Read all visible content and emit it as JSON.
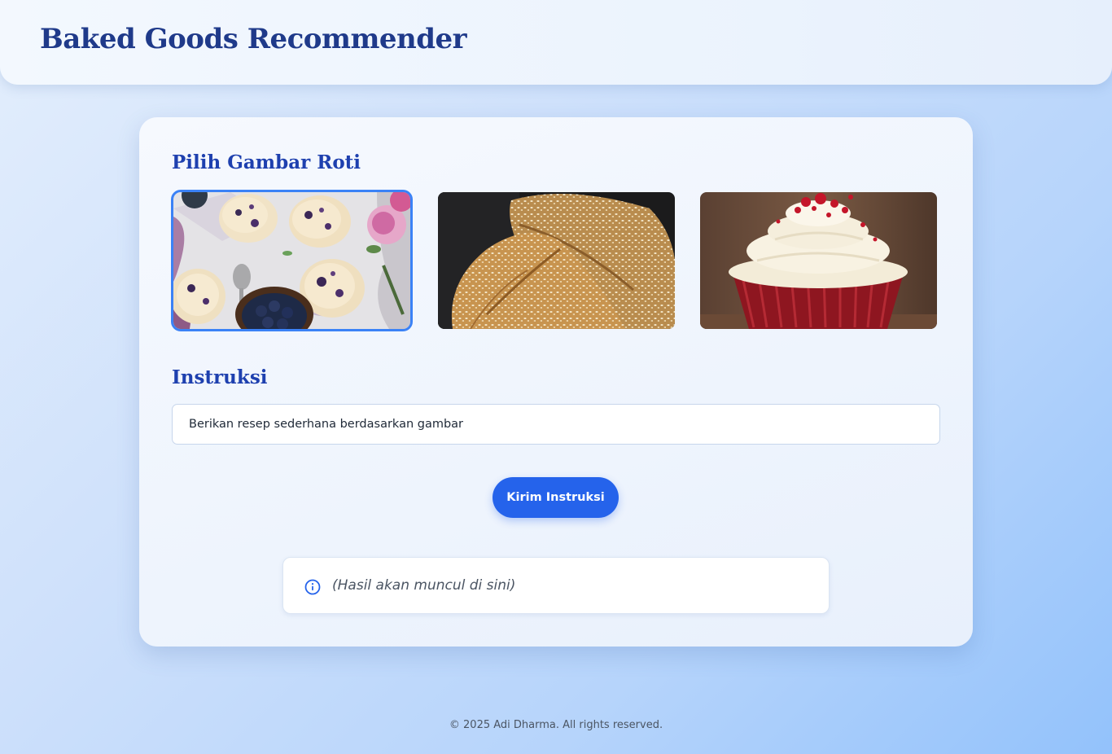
{
  "header": {
    "title": "Baked Goods Recommender"
  },
  "image_section": {
    "title": "Pilih Gambar Roti",
    "images": [
      {
        "subject": "blueberry scones with blueberries and flowers",
        "selected": true
      },
      {
        "subject": "crusty sesame bread loaves",
        "selected": false
      },
      {
        "subject": "red velvet cupcake with cream frosting",
        "selected": false
      }
    ]
  },
  "instruction_section": {
    "title": "Instruksi",
    "input_value": "Berikan resep sederhana berdasarkan gambar",
    "submit_label": "Kirim Instruksi"
  },
  "result": {
    "icon": "info-icon",
    "placeholder": "(Hasil akan muncul di sini)"
  },
  "footer": {
    "copyright": "© 2025 Adi Dharma. All rights reserved."
  },
  "colors": {
    "accent": "#2563eb",
    "heading": "#1e40af",
    "selected_border": "#3b82f6"
  }
}
